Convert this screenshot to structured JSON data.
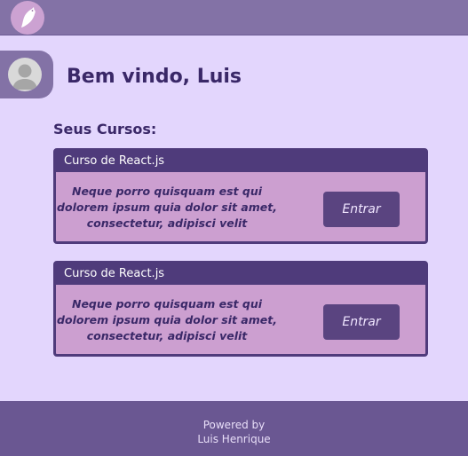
{
  "header": {
    "logo_icon": "bird-logo-icon"
  },
  "profile": {
    "avatar_icon": "user-avatar-icon",
    "welcome": "Bem vindo, Luis"
  },
  "courses": {
    "title": "Seus Cursos:",
    "items": [
      {
        "title": "Curso de React.js",
        "description": "Neque porro quisquam est qui dolorem ipsum quia dolor sit amet, consectetur, adipisci velit",
        "button_label": "Entrar"
      },
      {
        "title": "Curso de React.js",
        "description": "Neque porro quisquam est qui dolorem ipsum quia dolor sit amet, consectetur, adipisci velit",
        "button_label": "Entrar"
      }
    ]
  },
  "footer": {
    "line1": "Powered by",
    "line2": "Luis Henrique"
  },
  "colors": {
    "page_bg": "#E3D6FD",
    "topbar_bg": "#8372A6",
    "card_bg": "#CC9FD0",
    "card_border": "#4F3B7B",
    "button_bg": "#5A4480",
    "footer_bg": "#6A5792",
    "text_dark": "#3A2868"
  }
}
